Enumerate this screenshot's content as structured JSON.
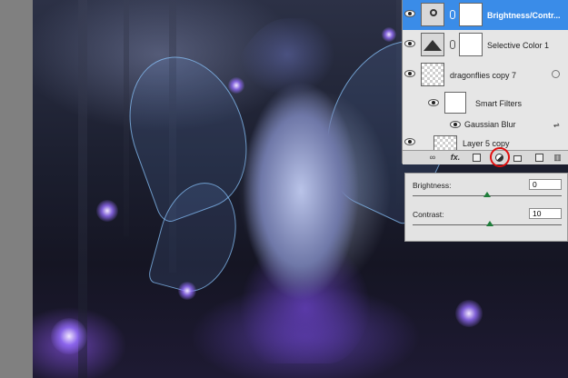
{
  "layers": [
    {
      "name": "Brightness/Contr...",
      "selected": true,
      "type": "adjustment",
      "icon": "sun-icon"
    },
    {
      "name": "Selective Color 1",
      "selected": false,
      "type": "adjustment",
      "icon": "selective-color-icon"
    },
    {
      "name": "dragonflies copy 7",
      "selected": false,
      "type": "smart-object",
      "smart_filters_label": "Smart Filters",
      "filter": "Gaussian Blur"
    },
    {
      "name": "Layer 5 copy",
      "selected": false,
      "type": "pixel"
    }
  ],
  "footer_icons": [
    "link-layers-icon",
    "fx-icon",
    "add-mask-icon",
    "new-adjustment-layer-icon",
    "new-group-icon",
    "new-layer-icon",
    "delete-layer-icon"
  ],
  "footer_fx_label": "fx.",
  "adjustments": {
    "brightness_label": "Brightness:",
    "brightness_value": "0",
    "brightness_fraction": 0.5,
    "contrast_label": "Contrast:",
    "contrast_value": "10",
    "contrast_fraction": 0.52
  },
  "colors": {
    "selection": "#3a8ce8",
    "highlight_ring": "#e01010",
    "slider_thumb": "#1e7d3a"
  }
}
